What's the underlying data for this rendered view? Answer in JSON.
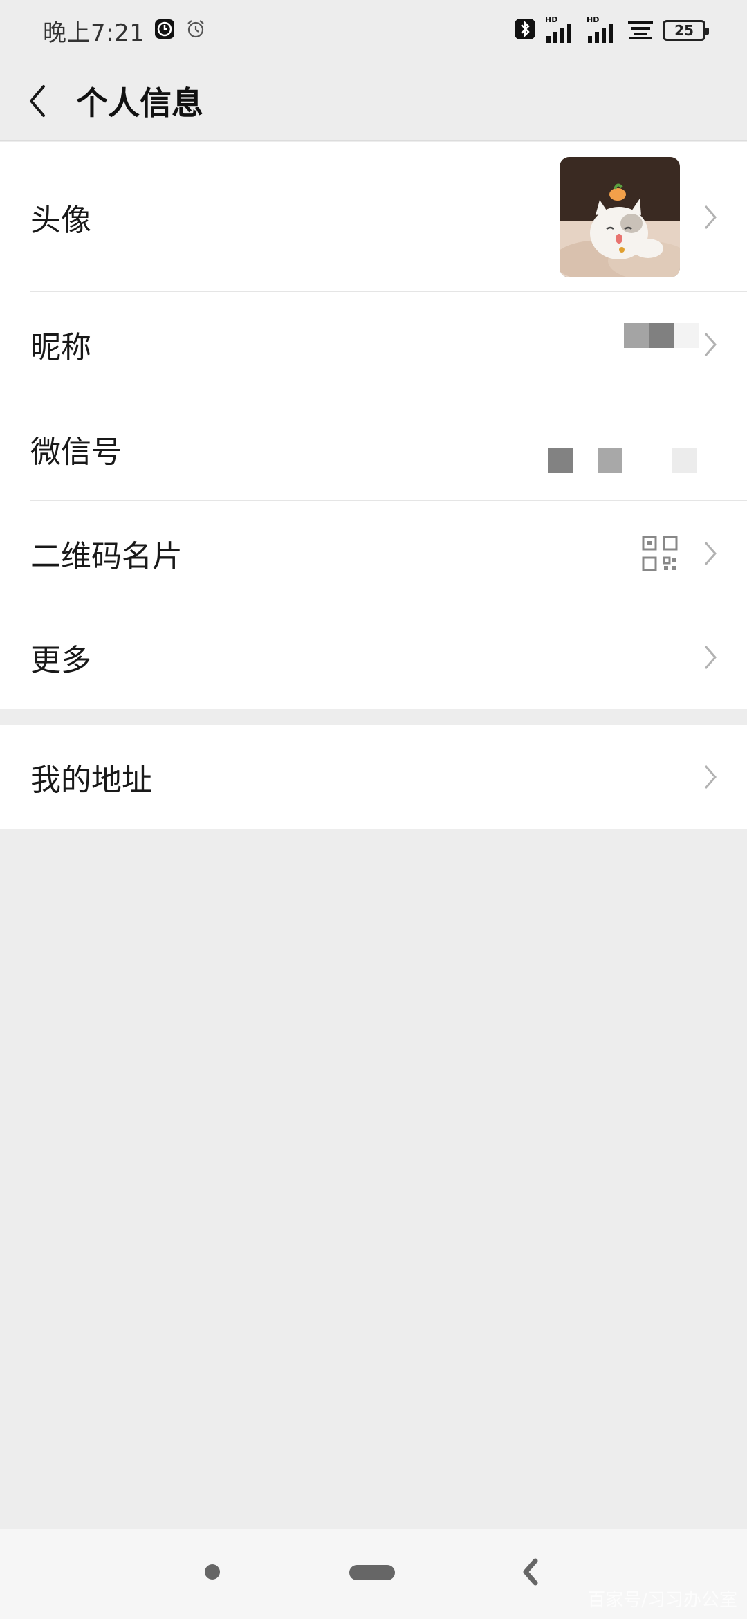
{
  "status_bar": {
    "time": "晚上7:21",
    "battery": "25",
    "hd_label": "HD"
  },
  "nav": {
    "title": "个人信息"
  },
  "rows": {
    "avatar_label": "头像",
    "nickname_label": "昵称",
    "wechat_id_label": "微信号",
    "qr_card_label": "二维码名片",
    "more_label": "更多",
    "address_label": "我的地址"
  },
  "watermark": "百家号/习习办公室",
  "colors": {
    "background": "#ededed",
    "cell": "#ffffff",
    "separator": "#e5e5e5",
    "chevron": "#b2b2b2",
    "text": "#191919"
  }
}
